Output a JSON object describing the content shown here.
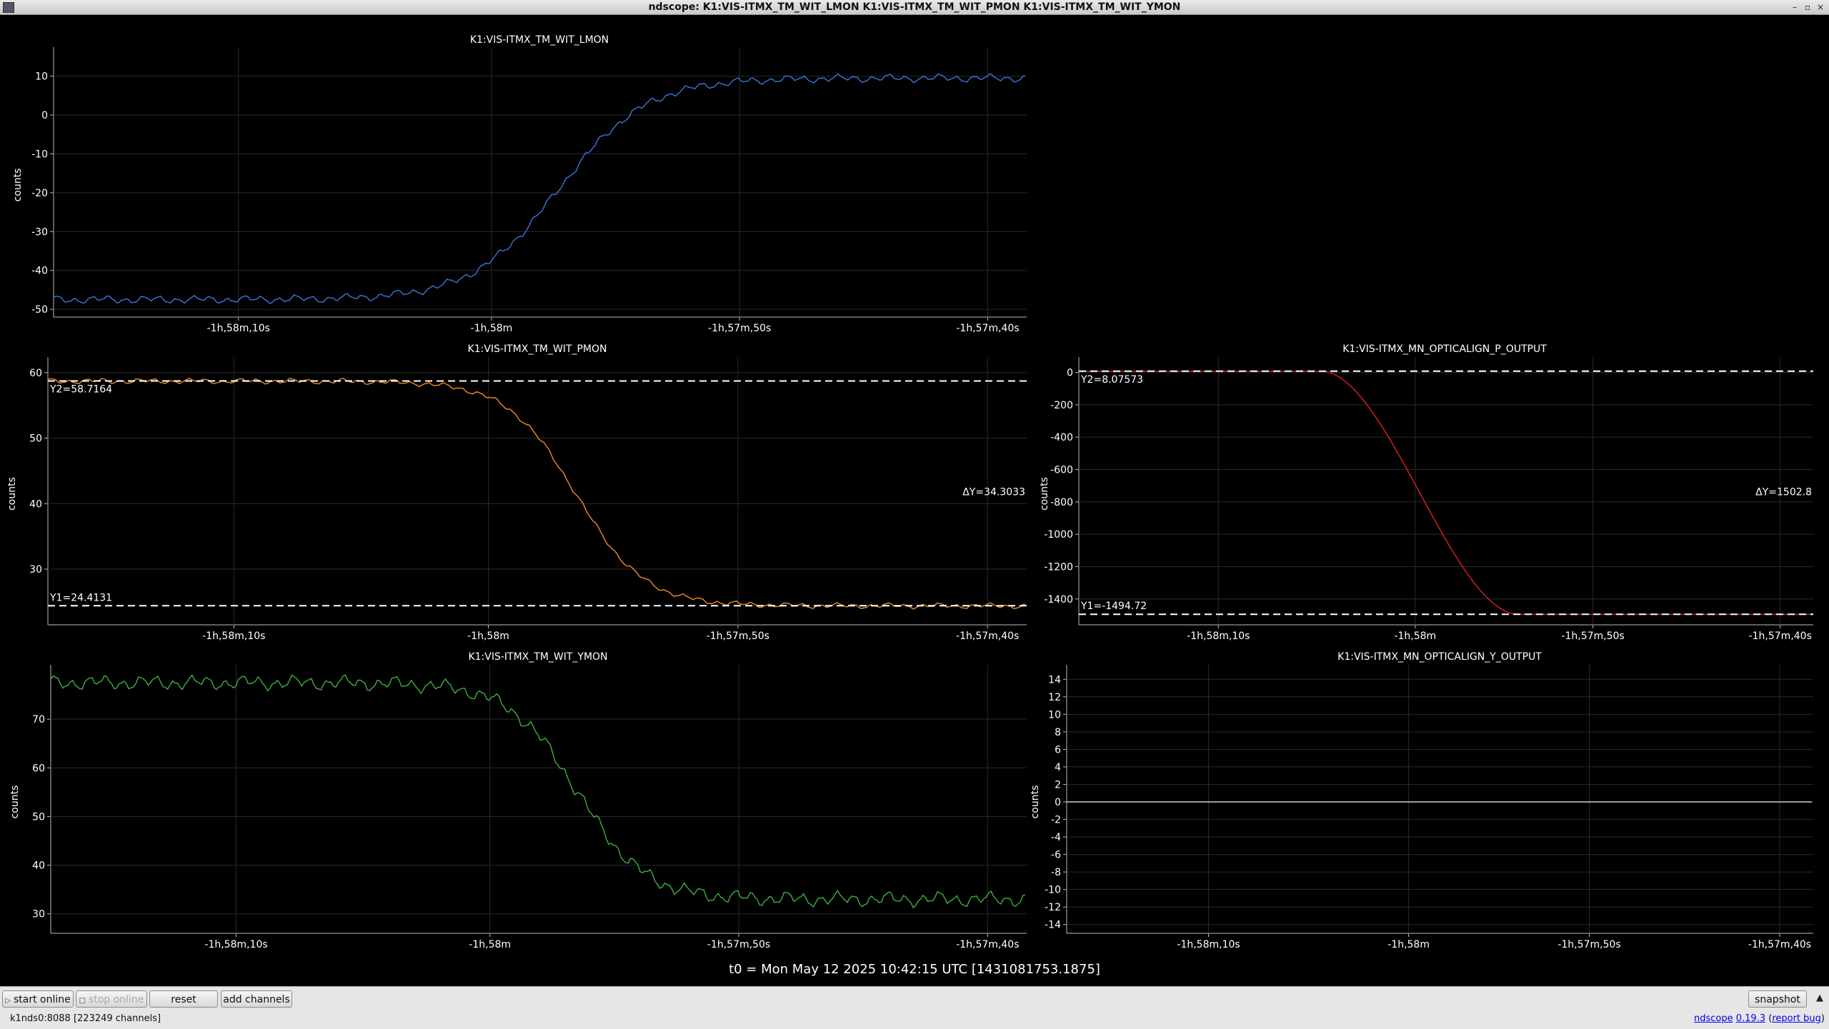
{
  "window": {
    "title": "ndscope: K1:VIS-ITMX_TM_WIT_LMON K1:VIS-ITMX_TM_WIT_PMON K1:VIS-ITMX_TM_WIT_YMON"
  },
  "colors": {
    "lmon": "#3a78d6",
    "pmon": "#f08a24",
    "ymon": "#3fb03f",
    "p_output": "#e02020",
    "y_output": "#cfcfcf",
    "cursor": "#ffffff"
  },
  "plots": [
    {
      "id": "lmon",
      "title": "K1:VIS-ITMX_TM_WIT_LMON",
      "ylabel": "counts",
      "ylim": [
        -52,
        16
      ],
      "yticks": [
        10,
        0,
        -10,
        -20,
        -30,
        -40,
        -50
      ],
      "color": "lmon",
      "kind": "rise",
      "y_start": -47.5,
      "y_end": 9.5,
      "noise": 1.2
    },
    {
      "id": "pmon",
      "title": "K1:VIS-ITMX_TM_WIT_PMON",
      "ylabel": "counts",
      "ylim": [
        21.5,
        61.5
      ],
      "yticks": [
        60,
        50,
        40,
        30
      ],
      "color": "pmon",
      "kind": "fall",
      "y_start": 58.7,
      "y_end": 24.4,
      "noise": 0.5,
      "cursors": {
        "y2_label": "Y2=58.7164",
        "y2": 58.7164,
        "y1_label": "Y1=24.4131",
        "y1": 24.4131,
        "dy_label": "ΔY=34.3033"
      }
    },
    {
      "id": "ymon",
      "title": "K1:VIS-ITMX_TM_WIT_YMON",
      "ylabel": "counts",
      "ylim": [
        26,
        80
      ],
      "yticks": [
        70,
        60,
        50,
        40,
        30
      ],
      "color": "ymon",
      "kind": "fall",
      "y_start": 77.5,
      "y_end": 33,
      "noise": 1.8
    },
    {
      "id": "p_output",
      "title": "K1:VIS-ITMX_MN_OPTICALIGN_P_OUTPUT",
      "ylabel": "counts",
      "ylim": [
        -1560,
        60
      ],
      "yticks": [
        0,
        -200,
        -400,
        -600,
        -800,
        -1000,
        -1200,
        -1400
      ],
      "color": "p_output",
      "kind": "smoothfall",
      "y_start": 8.07573,
      "y_end": -1494.72,
      "noise": 0,
      "cursors": {
        "y2_label": "Y2=8.07573",
        "y2": 8.07573,
        "y1_label": "Y1=-1494.72",
        "y1": -1494.72,
        "dy_label": "ΔY=1502.8"
      }
    },
    {
      "id": "y_output",
      "title": "K1:VIS-ITMX_MN_OPTICALIGN_Y_OUTPUT",
      "ylabel": "counts",
      "ylim": [
        -15,
        15
      ],
      "yticks": [
        14,
        12,
        10,
        8,
        6,
        4,
        2,
        0,
        -2,
        -4,
        -6,
        -8,
        -10,
        -12,
        -14
      ],
      "color": "y_output",
      "kind": "flat",
      "y_start": 0,
      "y_end": 0,
      "noise": 0
    }
  ],
  "xticks": [
    "-1h,58m,10s",
    "-1h,58m",
    "-1h,57m,50s",
    "-1h,57m,40s"
  ],
  "t0_label": "t0 = Mon May 12 2025 10:42:15 UTC [1431081753.1875]",
  "toolbar": {
    "start_online": "start online",
    "stop_online": "stop online",
    "reset": "reset",
    "add_channels": "add channels",
    "snapshot": "snapshot"
  },
  "status": {
    "server": "k1nds0:8088",
    "channels": "[223249 channels]",
    "app_name": "ndscope",
    "version": "0.19.3",
    "report_bug": "report bug"
  }
}
